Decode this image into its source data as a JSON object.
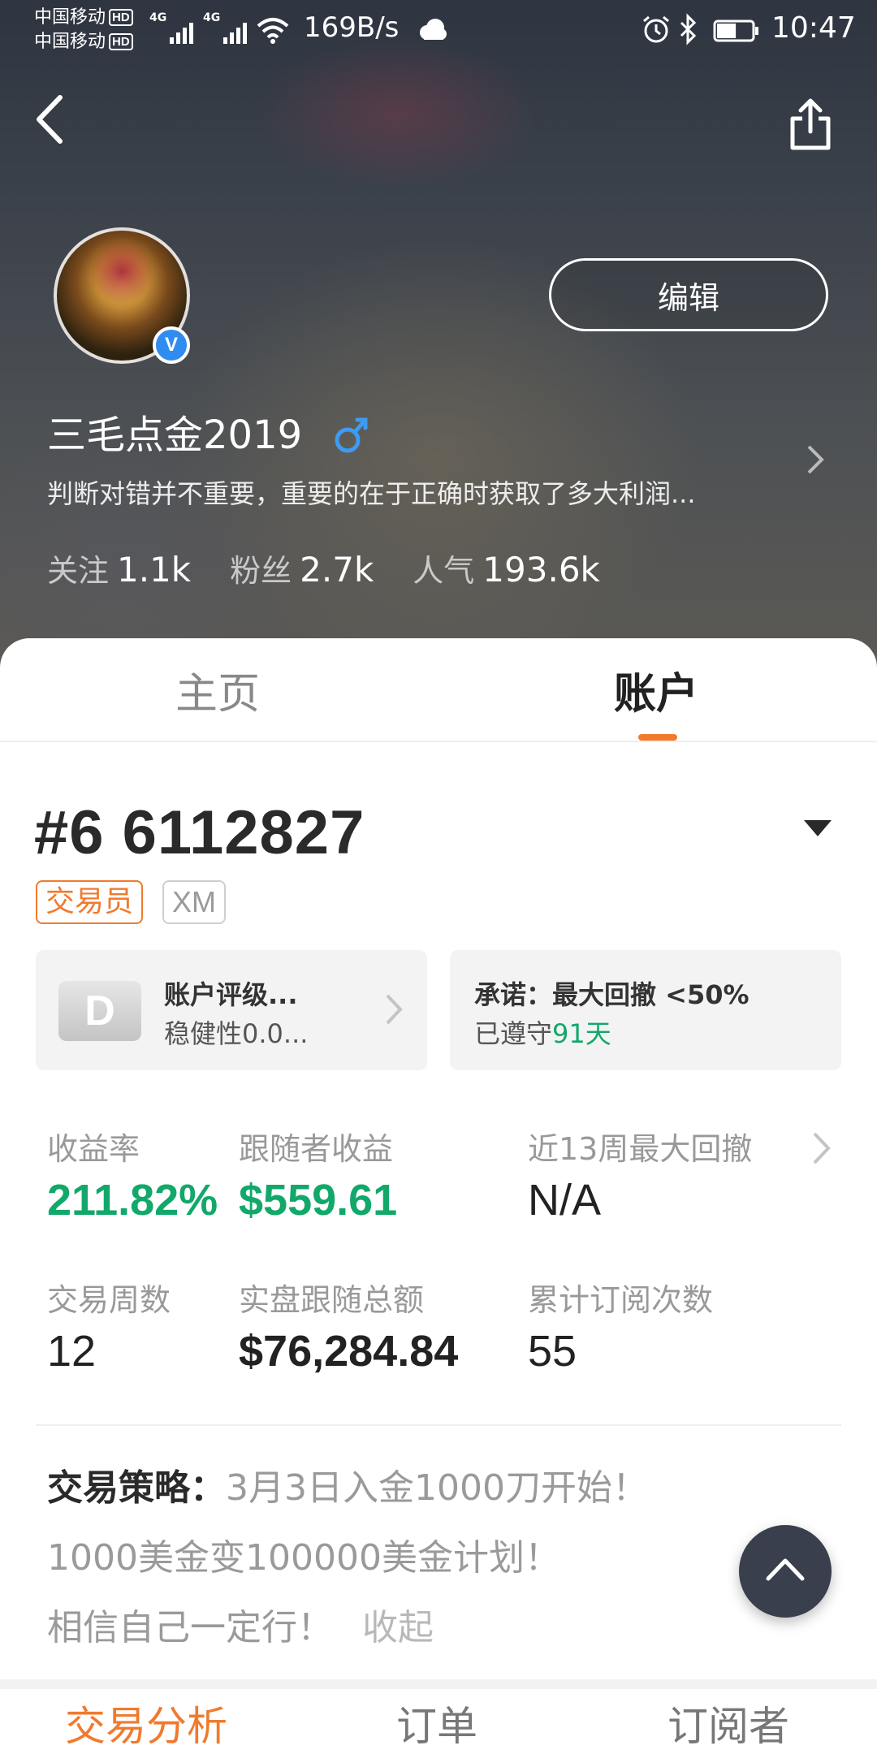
{
  "status_bar": {
    "carrier_1": "中国移动",
    "carrier_2": "中国移动",
    "hd_badge": "HD",
    "network_1": "4G",
    "network_2": "4G",
    "net_speed": "169B/s",
    "time": "10:47",
    "battery_level": 0.55
  },
  "header": {
    "edit_label": "编辑",
    "username": "三毛点金2019",
    "gender_symbol": "♂",
    "verified_mark": "V",
    "bio": "判断对错并不重要，重要的在于正确时获取了多大利润...",
    "stats": [
      {
        "label": "关注",
        "value": "1.1k"
      },
      {
        "label": "粉丝",
        "value": "2.7k"
      },
      {
        "label": "人气",
        "value": "193.6k"
      }
    ]
  },
  "tabs": {
    "home": "主页",
    "account": "账户",
    "active": "account"
  },
  "account": {
    "number": "#6 6112827",
    "tag_role": "交易员",
    "tag_broker": "XM",
    "rating_card": {
      "grade": "D",
      "title": "账户评级...",
      "subtitle": "稳健性0.0..."
    },
    "promise_card": {
      "title": "承诺：最大回撤 <50%",
      "subtitle_prefix": "已遵守",
      "subtitle_days": "91天"
    },
    "metrics": [
      {
        "label": "收益率",
        "value": "211.82%"
      },
      {
        "label": "跟随者收益",
        "value": "$559.61"
      },
      {
        "label": "近13周最大回撤",
        "value": "N/A"
      },
      {
        "label": "交易周数",
        "value": "12"
      },
      {
        "label": "实盘跟随总额",
        "value": "$76,284.84"
      },
      {
        "label": "累计订阅次数",
        "value": "55"
      }
    ],
    "strategy": {
      "label": "交易策略：",
      "line1": "3月3日入金1000刀开始！",
      "line2": "1000美金变100000美金计划！",
      "line3": "相信自己一定行！",
      "collapse": "收起"
    }
  },
  "sub_tabs": {
    "analysis": "交易分析",
    "orders": "订单",
    "subscribers": "订阅者"
  },
  "colors": {
    "accent": "#f07a2e",
    "positive": "#12a86a",
    "fab": "#3a3f4d",
    "verified": "#2f8cf0"
  },
  "icons": [
    "back-icon",
    "share-icon",
    "alarm-icon",
    "bluetooth-icon",
    "battery-icon",
    "wifi-icon",
    "cloud-icon",
    "gender-male-icon",
    "chevron-right-icon",
    "dropdown-triangle-icon",
    "arrow-up-icon"
  ]
}
